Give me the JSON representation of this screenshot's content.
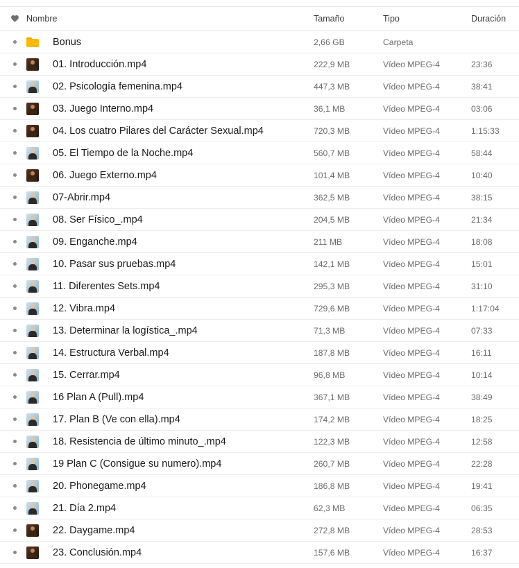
{
  "columns": {
    "name": "Nombre",
    "size": "Tamaño",
    "type": "Tipo",
    "duration": "Duración"
  },
  "rows": [
    {
      "name": "Bonus",
      "size": "2,66 GB",
      "type": "Carpeta",
      "duration": "",
      "icon": "folder-icon"
    },
    {
      "name": "01. Introducción.mp4",
      "size": "222,9 MB",
      "type": "Vídeo MPEG-4",
      "duration": "23:36",
      "icon": "video-thumbnail-icon"
    },
    {
      "name": "02. Psicología femenina.mp4",
      "size": "447,3 MB",
      "type": "Vídeo MPEG-4",
      "duration": "38:41",
      "icon": "video-thumbnail-icon"
    },
    {
      "name": "03. Juego Interno.mp4",
      "size": "36,1 MB",
      "type": "Vídeo MPEG-4",
      "duration": "03:06",
      "icon": "video-thumbnail-icon"
    },
    {
      "name": "04. Los cuatro Pilares del Carácter Sexual.mp4",
      "size": "720,3 MB",
      "type": "Vídeo MPEG-4",
      "duration": "1:15:33",
      "icon": "video-thumbnail-icon"
    },
    {
      "name": "05. El Tiempo de la Noche.mp4",
      "size": "560,7 MB",
      "type": "Vídeo MPEG-4",
      "duration": "58:44",
      "icon": "video-thumbnail-icon"
    },
    {
      "name": "06. Juego Externo.mp4",
      "size": "101,4 MB",
      "type": "Vídeo MPEG-4",
      "duration": "10:40",
      "icon": "video-thumbnail-icon"
    },
    {
      "name": "07-Abrir.mp4",
      "size": "362,5 MB",
      "type": "Vídeo MPEG-4",
      "duration": "38:15",
      "icon": "video-thumbnail-icon"
    },
    {
      "name": "08. Ser Físico_.mp4",
      "size": "204,5 MB",
      "type": "Vídeo MPEG-4",
      "duration": "21:34",
      "icon": "video-thumbnail-icon"
    },
    {
      "name": "09. Enganche.mp4",
      "size": "211 MB",
      "type": "Vídeo MPEG-4",
      "duration": "18:08",
      "icon": "video-thumbnail-icon"
    },
    {
      "name": "10. Pasar sus pruebas.mp4",
      "size": "142,1 MB",
      "type": "Vídeo MPEG-4",
      "duration": "15:01",
      "icon": "video-thumbnail-icon"
    },
    {
      "name": "11. Diferentes Sets.mp4",
      "size": "295,3 MB",
      "type": "Vídeo MPEG-4",
      "duration": "31:10",
      "icon": "video-thumbnail-icon"
    },
    {
      "name": "12. Vibra.mp4",
      "size": "729,6 MB",
      "type": "Vídeo MPEG-4",
      "duration": "1:17:04",
      "icon": "video-thumbnail-icon"
    },
    {
      "name": "13. Determinar la logística_.mp4",
      "size": "71,3 MB",
      "type": "Vídeo MPEG-4",
      "duration": "07:33",
      "icon": "video-thumbnail-icon"
    },
    {
      "name": "14. Estructura Verbal.mp4",
      "size": "187,8 MB",
      "type": "Vídeo MPEG-4",
      "duration": "16:11",
      "icon": "video-thumbnail-icon"
    },
    {
      "name": "15. Cerrar.mp4",
      "size": "96,8 MB",
      "type": "Vídeo MPEG-4",
      "duration": "10:14",
      "icon": "video-thumbnail-icon"
    },
    {
      "name": "16 Plan A (Pull).mp4",
      "size": "367,1 MB",
      "type": "Vídeo MPEG-4",
      "duration": "38:49",
      "icon": "video-thumbnail-icon"
    },
    {
      "name": "17. Plan B (Ve con ella).mp4",
      "size": "174,2 MB",
      "type": "Vídeo MPEG-4",
      "duration": "18:25",
      "icon": "video-thumbnail-icon"
    },
    {
      "name": "18. Resistencia de último minuto_.mp4",
      "size": "122,3 MB",
      "type": "Vídeo MPEG-4",
      "duration": "12:58",
      "icon": "video-thumbnail-icon"
    },
    {
      "name": "19 Plan C (Consigue su numero).mp4",
      "size": "260,7 MB",
      "type": "Vídeo MPEG-4",
      "duration": "22:28",
      "icon": "video-thumbnail-icon"
    },
    {
      "name": "20. Phonegame.mp4",
      "size": "186,8 MB",
      "type": "Vídeo MPEG-4",
      "duration": "19:41",
      "icon": "video-thumbnail-icon"
    },
    {
      "name": "21. Día 2.mp4",
      "size": "62,3 MB",
      "type": "Vídeo MPEG-4",
      "duration": "06:35",
      "icon": "video-thumbnail-icon"
    },
    {
      "name": "22. Daygame.mp4",
      "size": "272,8 MB",
      "type": "Vídeo MPEG-4",
      "duration": "28:53",
      "icon": "video-thumbnail-icon"
    },
    {
      "name": "23. Conclusión.mp4",
      "size": "157,6 MB",
      "type": "Vídeo MPEG-4",
      "duration": "16:37",
      "icon": "video-thumbnail-icon"
    }
  ],
  "colors": {
    "folder": "#ffb900",
    "divider": "#ececec",
    "secondary_text": "#6b6b6b"
  }
}
